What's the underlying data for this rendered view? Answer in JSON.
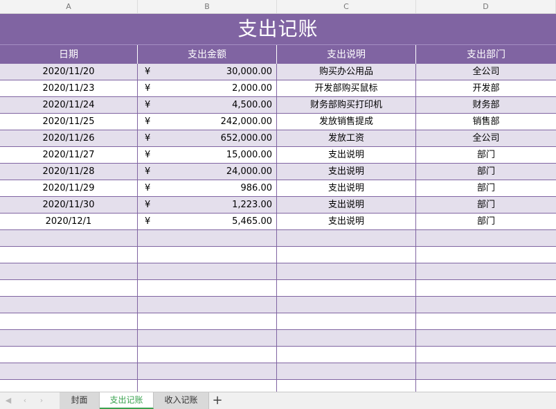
{
  "columns": [
    "A",
    "B",
    "C",
    "D"
  ],
  "title": "支出记账",
  "headers": [
    "日期",
    "支出金额",
    "支出说明",
    "支出部门"
  ],
  "currency_symbol": "¥",
  "rows": [
    {
      "date": "2020/11/20",
      "amount": "30,000.00",
      "desc": "购买办公用品",
      "dept": "全公司"
    },
    {
      "date": "2020/11/23",
      "amount": "2,000.00",
      "desc": "开发部购买鼠标",
      "dept": "开发部"
    },
    {
      "date": "2020/11/24",
      "amount": "4,500.00",
      "desc": "财务部购买打印机",
      "dept": "财务部"
    },
    {
      "date": "2020/11/25",
      "amount": "242,000.00",
      "desc": "发放销售提成",
      "dept": "销售部"
    },
    {
      "date": "2020/11/26",
      "amount": "652,000.00",
      "desc": "发放工资",
      "dept": "全公司"
    },
    {
      "date": "2020/11/27",
      "amount": "15,000.00",
      "desc": "支出说明",
      "dept": "部门"
    },
    {
      "date": "2020/11/28",
      "amount": "24,000.00",
      "desc": "支出说明",
      "dept": "部门"
    },
    {
      "date": "2020/11/29",
      "amount": "986.00",
      "desc": "支出说明",
      "dept": "部门"
    },
    {
      "date": "2020/11/30",
      "amount": "1,223.00",
      "desc": "支出说明",
      "dept": "部门"
    },
    {
      "date": "2020/12/1",
      "amount": "5,465.00",
      "desc": "支出说明",
      "dept": "部门"
    }
  ],
  "tabs": [
    {
      "label": "封面",
      "active": false
    },
    {
      "label": "支出记账",
      "active": true
    },
    {
      "label": "收入记账",
      "active": false
    }
  ],
  "add_tab_label": "+",
  "colors": {
    "header_purple": "#8064a2",
    "row_shade": "#e4dfec",
    "active_tab_green": "#3aa24f"
  }
}
